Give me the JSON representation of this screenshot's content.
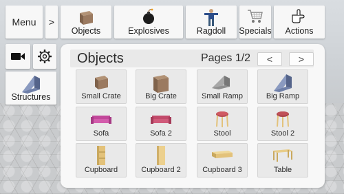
{
  "toolbar": {
    "menu_label": "Menu",
    "expand_label": ">",
    "categories": [
      {
        "label": "Objects",
        "icon": "crate-icon"
      },
      {
        "label": "Explosives",
        "icon": "bomb-icon"
      },
      {
        "label": "Ragdoll",
        "icon": "ragdoll-icon"
      },
      {
        "label": "Specials",
        "icon": "shopping-cart-icon"
      },
      {
        "label": "Actions",
        "icon": "pointing-hand-icon"
      }
    ]
  },
  "side": {
    "camera_icon": "camera-icon",
    "settings_icon": "gear-icon",
    "structures_label": "Structures",
    "structures_icon": "ramp-icon"
  },
  "panel": {
    "title": "Objects",
    "pages": "Pages 1/2",
    "prev_label": "<",
    "next_label": ">",
    "items": [
      {
        "label": "Small Crate",
        "icon": "small-crate-icon"
      },
      {
        "label": "Big Crate",
        "icon": "big-crate-icon"
      },
      {
        "label": "Small Ramp",
        "icon": "small-ramp-icon"
      },
      {
        "label": "Big Ramp",
        "icon": "big-ramp-icon"
      },
      {
        "label": "Sofa",
        "icon": "sofa-icon"
      },
      {
        "label": "Sofa 2",
        "icon": "sofa-icon"
      },
      {
        "label": "Stool",
        "icon": "stool-icon"
      },
      {
        "label": "Stool 2",
        "icon": "stool-icon"
      },
      {
        "label": "Cupboard",
        "icon": "cupboard-icon"
      },
      {
        "label": "Cupboard 2",
        "icon": "cupboard-icon"
      },
      {
        "label": "Cupboard 3",
        "icon": "low-cupboard-icon"
      },
      {
        "label": "Table",
        "icon": "table-icon"
      }
    ]
  },
  "colors": {
    "panel_bg": "#f8f8f8",
    "tile_bg": "#e9e9e9",
    "sofa": "#c2479a",
    "stool": "#b84a52",
    "wood": "#e3c27a",
    "crate": "#9b7a60",
    "ramp": "#6e7fa8"
  }
}
